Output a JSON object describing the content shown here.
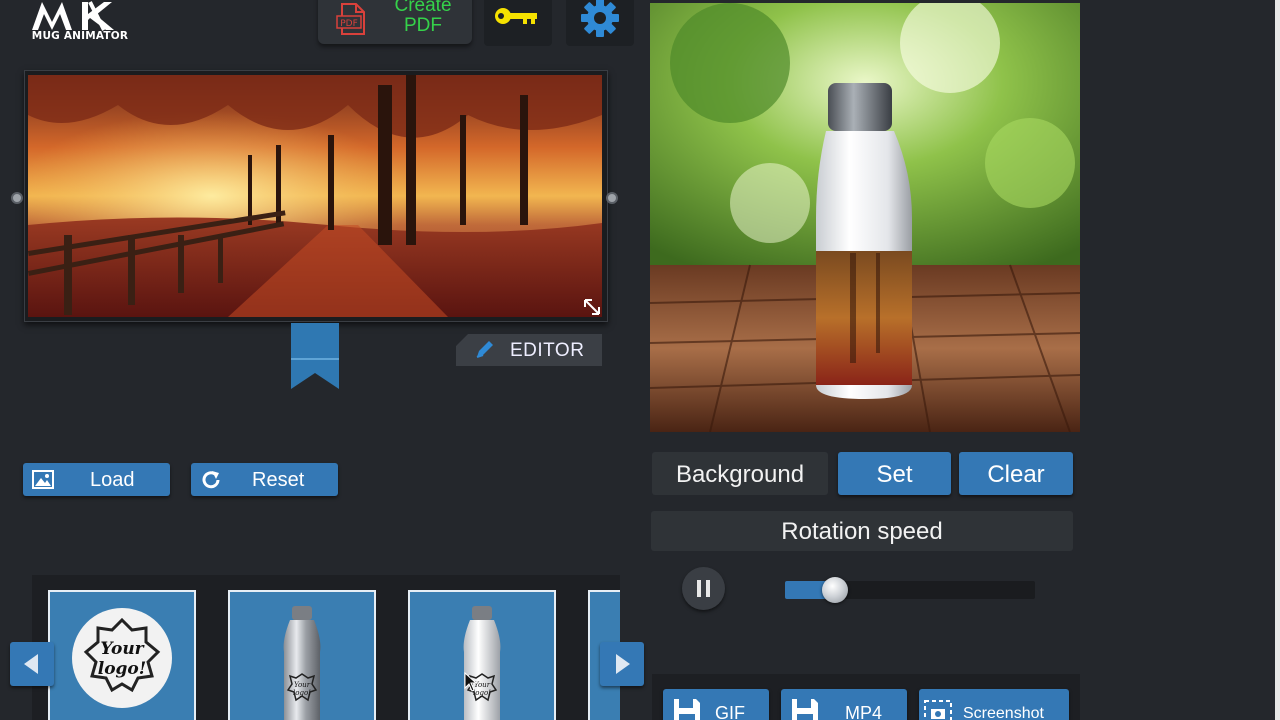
{
  "app": {
    "logo_text": "MUG ANIMATOR",
    "accent": "#3478b5"
  },
  "toolbar": {
    "create_pdf": {
      "line1": "Create",
      "line2": "PDF",
      "icon": "pdf-icon",
      "color": "#35d24a"
    },
    "key": {
      "icon": "key-icon",
      "color": "#f5e100"
    },
    "settings": {
      "icon": "gear-icon",
      "color": "#2f8ad6"
    }
  },
  "editor": {
    "editor_label": "EDITOR",
    "load_label": "Load",
    "reset_label": "Reset"
  },
  "carousel": {
    "items": [
      {
        "name": "logo-badge",
        "text_line1": "Your",
        "text_line2": "logo!"
      },
      {
        "name": "silver-bottle",
        "text_line1": "Your",
        "text_line2": "logo!"
      },
      {
        "name": "white-bottle",
        "text_line1": "Your",
        "text_line2": "logo!"
      }
    ]
  },
  "preview": {
    "background_label": "Background",
    "set_label": "Set",
    "clear_label": "Clear",
    "rotation_label": "Rotation speed",
    "rotation_value": 0.2
  },
  "export": {
    "gif_label": "GIF",
    "mp4_label": "MP4",
    "screenshot_label": "Screenshot"
  }
}
